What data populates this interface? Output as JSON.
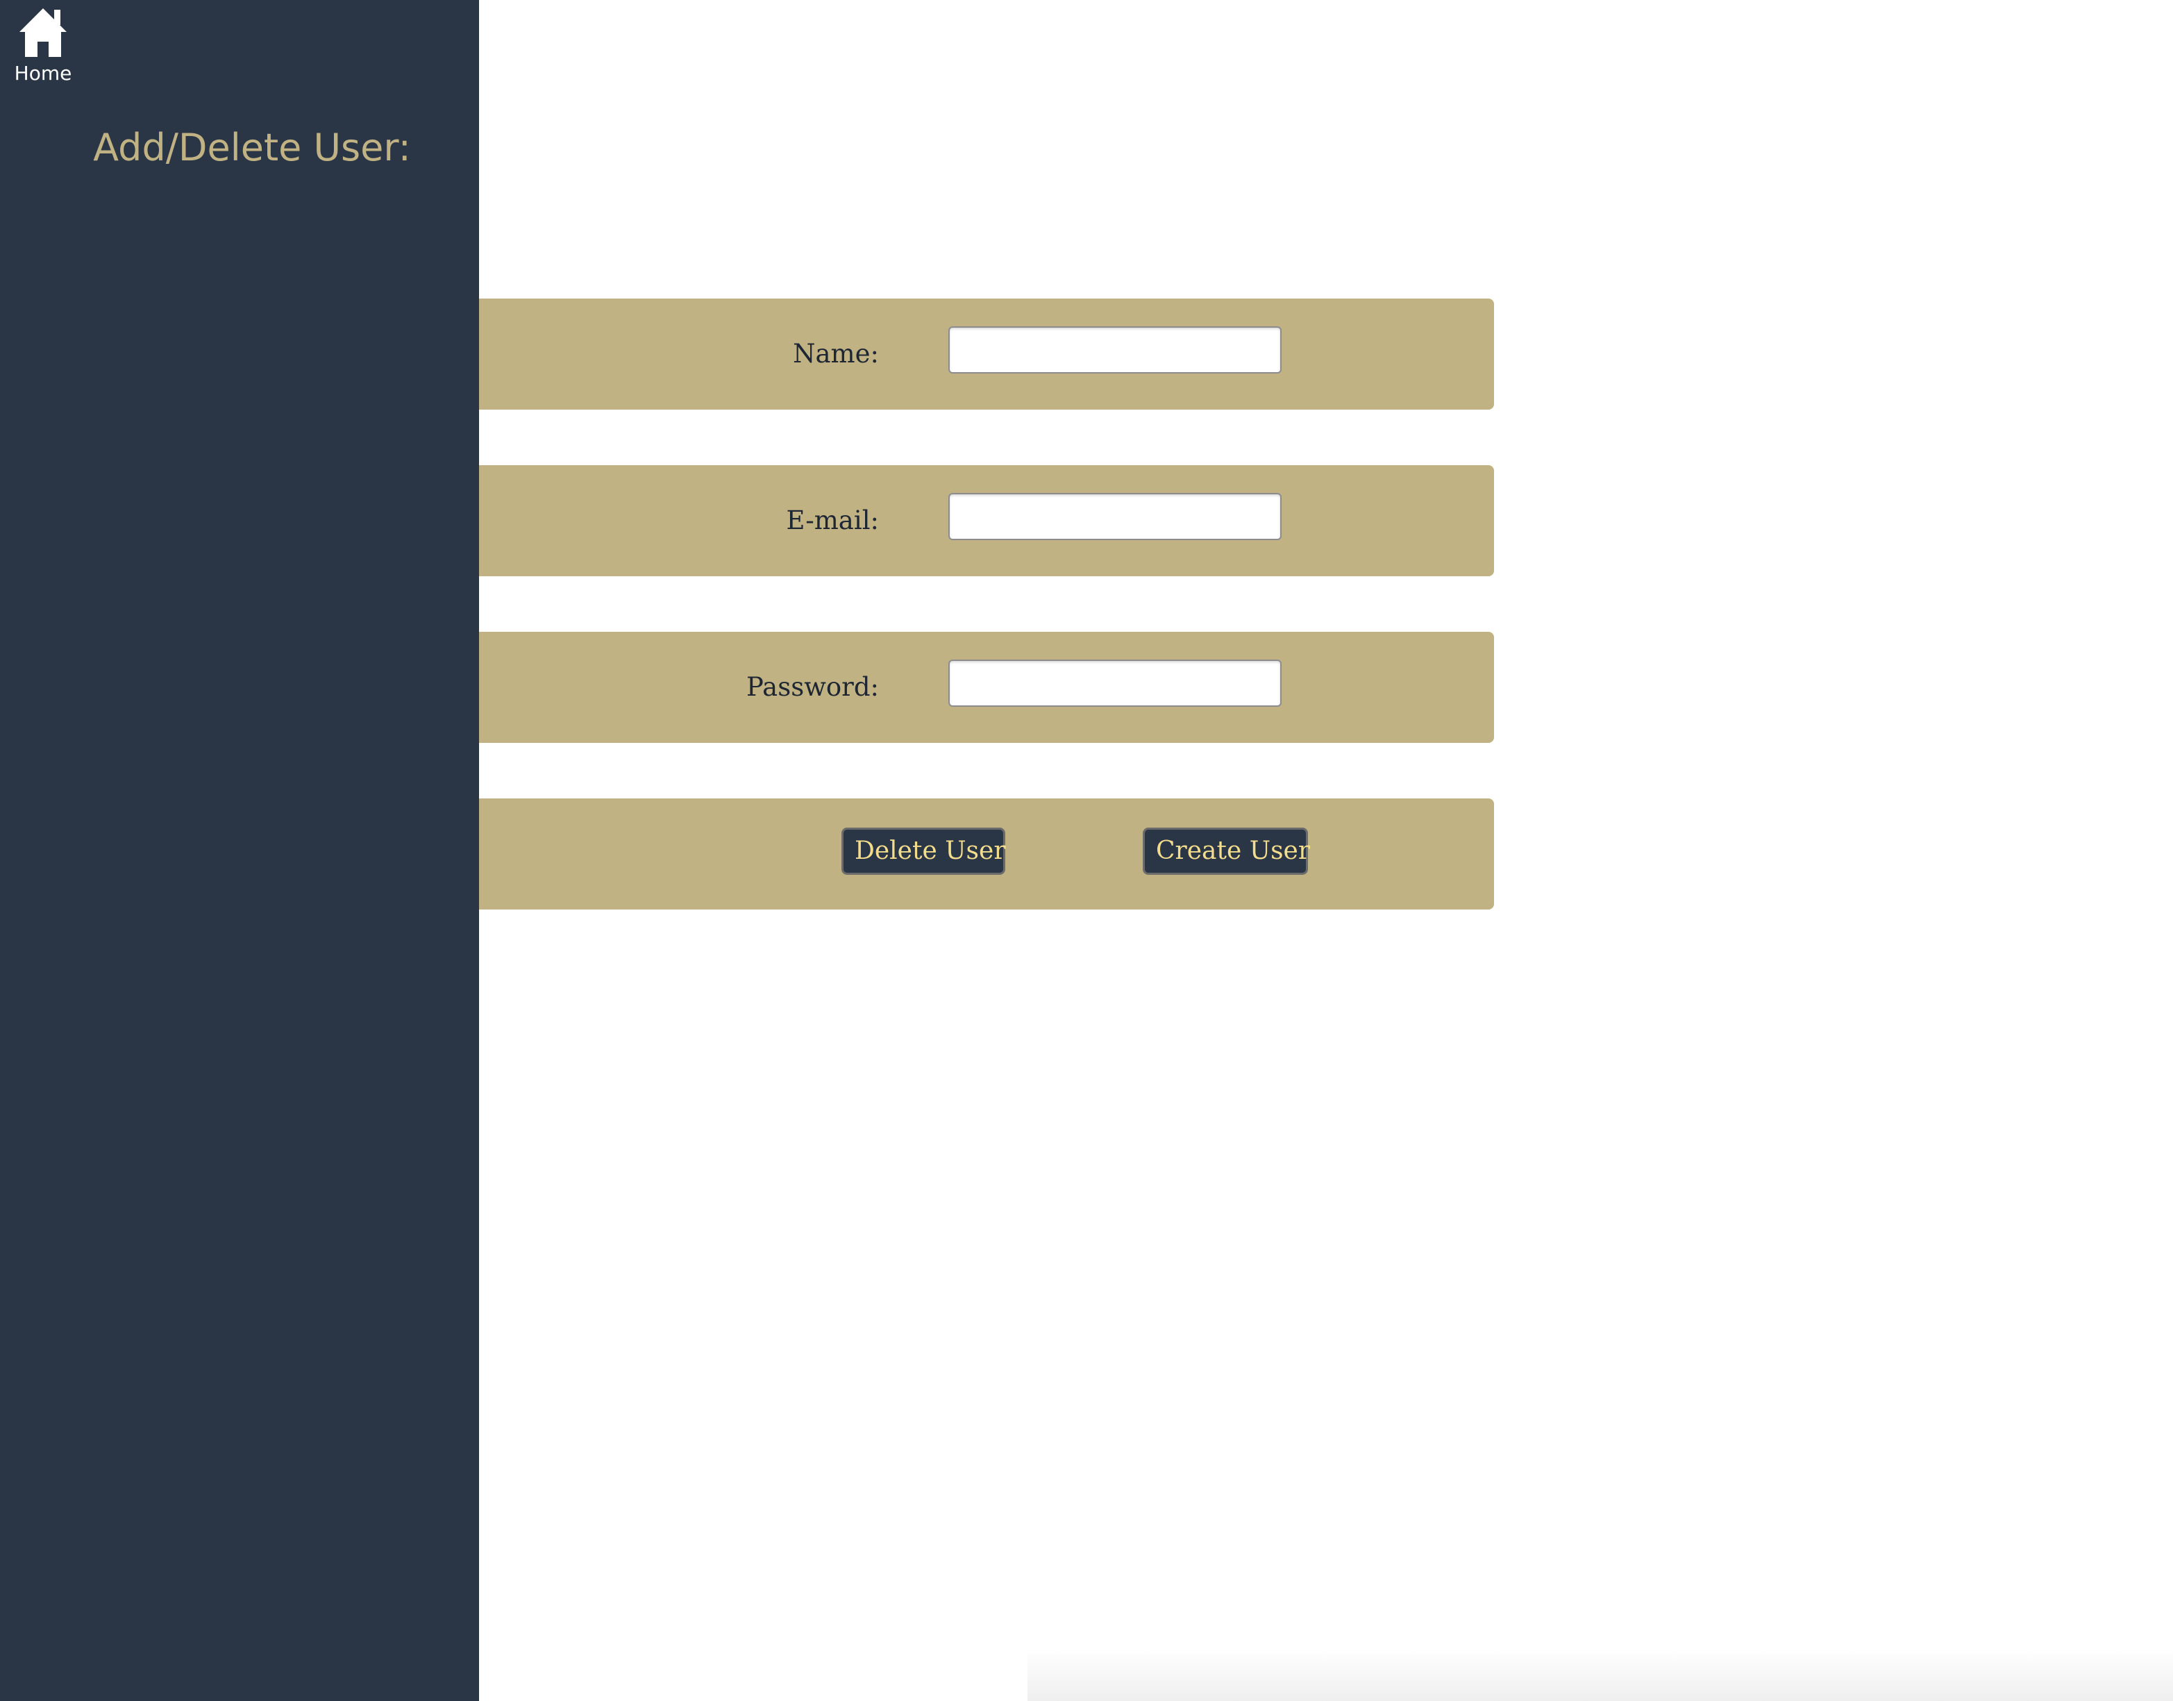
{
  "sidebar": {
    "home_icon": "home-icon",
    "home_label": "Home",
    "title": "Add/Delete User:"
  },
  "form": {
    "name": {
      "label": "Name:",
      "value": ""
    },
    "email": {
      "label": "E-mail:",
      "value": ""
    },
    "password": {
      "label": "Password:",
      "value": ""
    }
  },
  "actions": {
    "delete_label": "Delete User",
    "create_label": "Create User"
  },
  "colors": {
    "sidebar_bg": "#2a3545",
    "accent_tan": "#c0b283",
    "button_text": "#f3dc8c",
    "label_text": "#1e2634"
  }
}
